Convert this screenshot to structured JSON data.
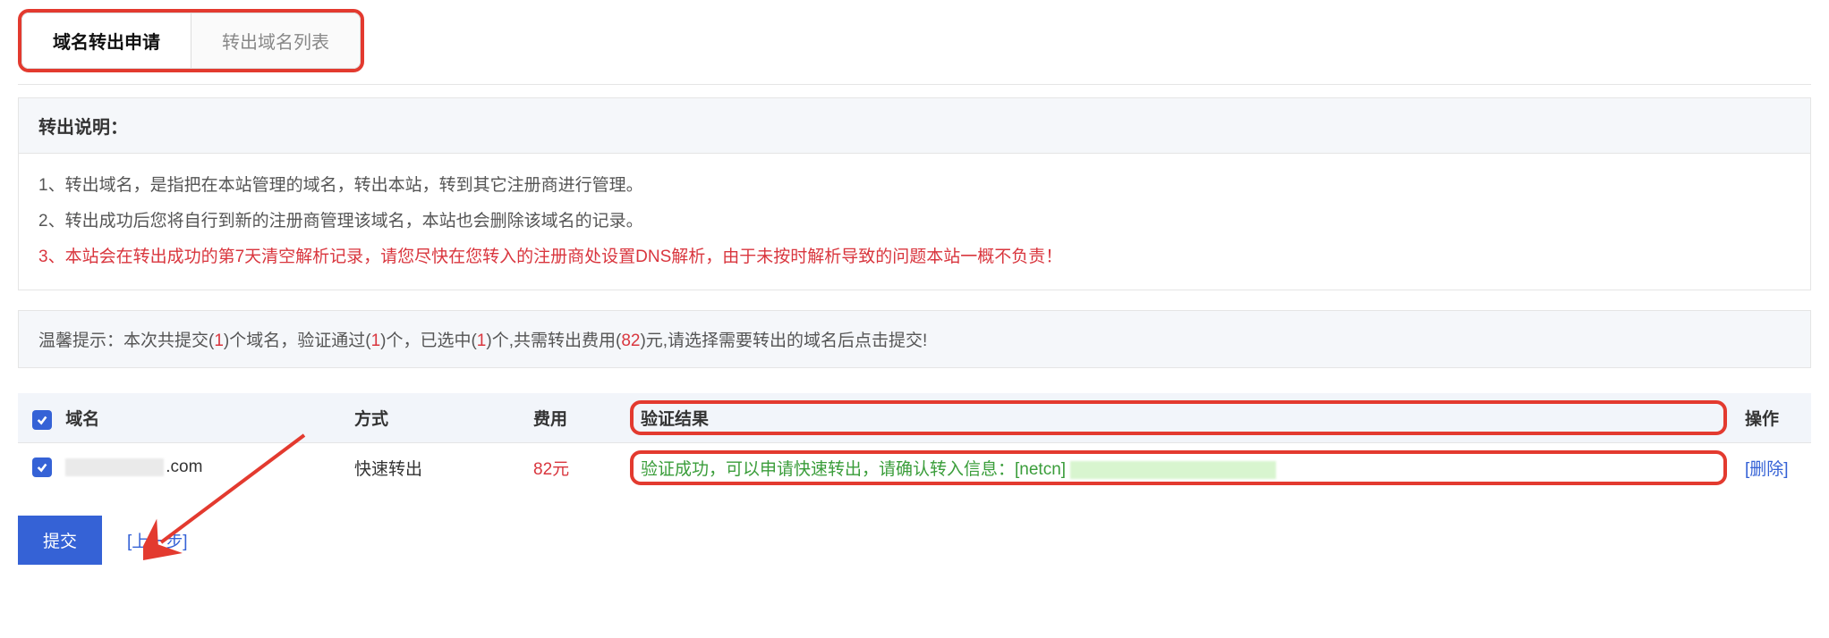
{
  "tabs": {
    "active": "域名转出申请",
    "inactive": "转出域名列表"
  },
  "instructions": {
    "title": "转出说明：",
    "line1": "1、转出域名，是指把在本站管理的域名，转出本站，转到其它注册商进行管理。",
    "line2": "2、转出成功后您将自行到新的注册商管理该域名，本站也会删除该域名的记录。",
    "line3": "3、本站会在转出成功的第7天清空解析记录，请您尽快在您转入的注册商处设置DNS解析，由于未按时解析导致的问题本站一概不负责！"
  },
  "tip": {
    "prefix": "温馨提示：本次共提交(",
    "count1": "1",
    "mid1": ")个域名，验证通过(",
    "count2": "1",
    "mid2": ")个，已选中(",
    "count3": "1",
    "mid3": ")个,共需转出费用(",
    "fee": "82",
    "suffix": ")元,请选择需要转出的域名后点击提交!"
  },
  "table": {
    "headers": {
      "domain": "域名",
      "method": "方式",
      "fee": "费用",
      "result": "验证结果",
      "action": "操作"
    },
    "rows": [
      {
        "domain_suffix": ".com",
        "method": "快速转出",
        "fee": "82元",
        "result_prefix": "验证成功，可以申请快速转出，请确认转入信息：[netcn] ",
        "action": "[删除]"
      }
    ]
  },
  "footer": {
    "submit": "提交",
    "back": "[上一步]"
  }
}
